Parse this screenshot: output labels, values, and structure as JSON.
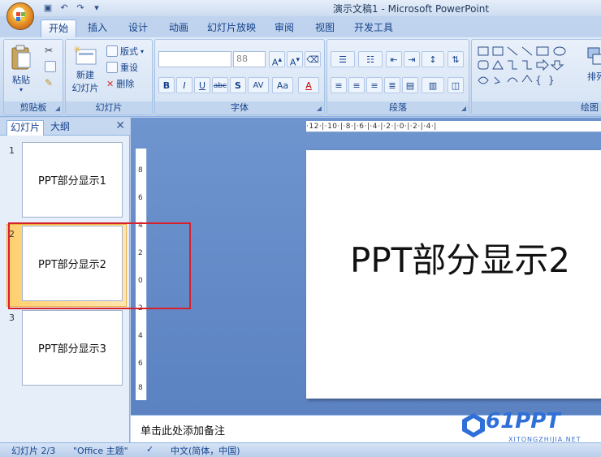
{
  "window": {
    "title": "演示文稿1 - Microsoft PowerPoint"
  },
  "ribbon_tabs": [
    "开始",
    "插入",
    "设计",
    "动画",
    "幻灯片放映",
    "审阅",
    "视图",
    "开发工具"
  ],
  "groups": {
    "clipboard": {
      "label": "剪贴板",
      "paste": "粘贴"
    },
    "slides": {
      "label": "幻灯片",
      "new_slide_line1": "新建",
      "new_slide_line2": "幻灯片",
      "layout": "版式",
      "reset": "重设",
      "delete": "删除"
    },
    "font": {
      "label": "字体",
      "size": "88",
      "bold": "B",
      "italic": "I",
      "underline": "U",
      "strike": "abc",
      "shadow": "S",
      "spacing": "AV",
      "case": "Aa",
      "color": "A"
    },
    "paragraph": {
      "label": "段落"
    },
    "drawing": {
      "label": "绘图",
      "arrange": "排列"
    }
  },
  "left_panel": {
    "tab_slides": "幻灯片",
    "tab_outline": "大纲",
    "close": "✕",
    "slides": [
      {
        "num": "1",
        "text": "PPT部分显示1"
      },
      {
        "num": "2",
        "text": "PPT部分显示2"
      },
      {
        "num": "3",
        "text": "PPT部分显示3"
      }
    ]
  },
  "ruler": {
    "horizontal": "·12·|·10·|·8·|·6·|·4·|·2·|·0·|·2·|·4·|",
    "vertical": [
      "8",
      "6",
      "4",
      "2",
      "0",
      "2",
      "4",
      "6",
      "8"
    ]
  },
  "slide": {
    "text": "PPT部分显示2"
  },
  "notes": {
    "placeholder": "单击此处添加备注"
  },
  "statusbar": {
    "slide_count": "幻灯片 2/3",
    "theme": "\"Office 主题\"",
    "language": "中文(简体，中国)"
  },
  "watermark": {
    "main": "61PPT",
    "sub": "XITONGZHIJIA.NET"
  }
}
